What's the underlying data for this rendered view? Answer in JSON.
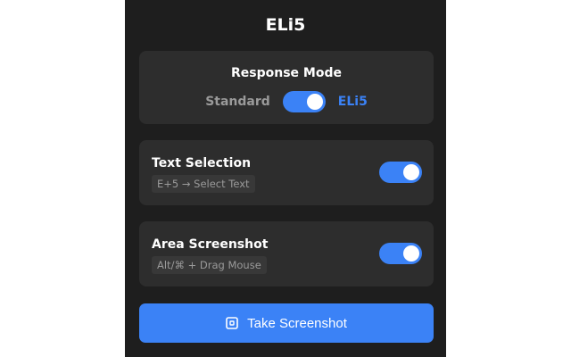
{
  "app": {
    "title": "ELi5"
  },
  "response_mode": {
    "heading": "Response Mode",
    "left_label": "Standard",
    "right_label": "ELi5",
    "selected": "ELi5"
  },
  "text_selection": {
    "title": "Text Selection",
    "shortcut": "E+5 → Select Text",
    "enabled": true
  },
  "area_screenshot": {
    "title": "Area Screenshot",
    "shortcut": "Alt/⌘ + Drag Mouse",
    "enabled": true
  },
  "actions": {
    "take_screenshot_label": "Take Screenshot",
    "take_screenshot_icon": "screenshot-frame-icon"
  },
  "colors": {
    "accent": "#3b82f6",
    "panel_bg": "#1e1e1e",
    "card_bg": "#2d2d2d",
    "muted_text": "#9a9a9a"
  }
}
